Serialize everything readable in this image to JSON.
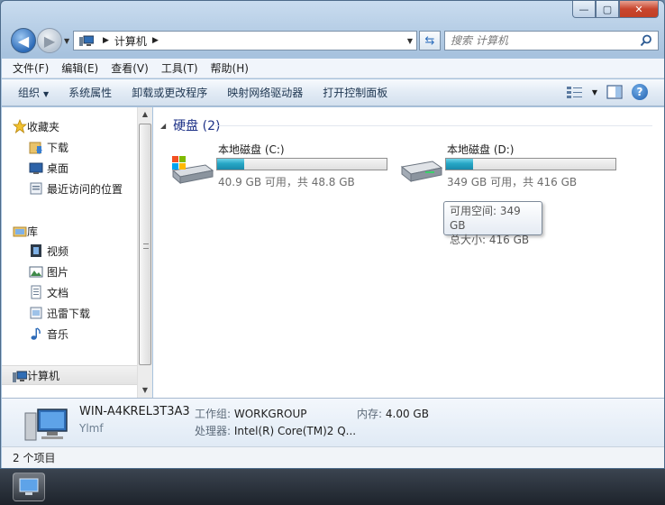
{
  "window": {
    "buttons": {
      "minimize": "—",
      "maximize": "▢",
      "close": "✕"
    }
  },
  "address": {
    "crumb": "计算机",
    "search_placeholder": "搜索 计算机"
  },
  "menu": [
    "文件(F)",
    "编辑(E)",
    "查看(V)",
    "工具(T)",
    "帮助(H)"
  ],
  "toolbar": {
    "organize": "组织",
    "commands": [
      "系统属性",
      "卸载或更改程序",
      "映射网络驱动器",
      "打开控制面板"
    ]
  },
  "nav": {
    "favorites": {
      "label": "收藏夹",
      "items": [
        "下载",
        "桌面",
        "最近访问的位置"
      ]
    },
    "libraries": {
      "label": "库",
      "items": [
        "视频",
        "图片",
        "文档",
        "迅雷下载",
        "音乐"
      ]
    },
    "computer": "计算机"
  },
  "content": {
    "group_title": "硬盘 (2)",
    "drives": [
      {
        "name": "本地磁盘 (C:)",
        "info": "40.9 GB 可用，共 48.8 GB",
        "used_fraction": 0.16
      },
      {
        "name": "本地磁盘 (D:)",
        "info": "349 GB 可用，共 416 GB",
        "used_fraction": 0.16
      }
    ],
    "tooltip": {
      "line1": "可用空间: 349 GB",
      "line2": "总大小: 416 GB"
    }
  },
  "details": {
    "name": "WIN-A4KREL3T3A3",
    "user": "Ylmf",
    "workgroup_label": "工作组:",
    "workgroup": "WORKGROUP",
    "memory_label": "内存:",
    "memory": "4.00 GB",
    "processor_label": "处理器:",
    "processor": "Intel(R) Core(TM)2 Q..."
  },
  "status": {
    "count": "2 个项目"
  },
  "colors": {
    "accent": "#1e3287",
    "drive_fill": "#26a7c5",
    "close_red": "#c8452d"
  }
}
